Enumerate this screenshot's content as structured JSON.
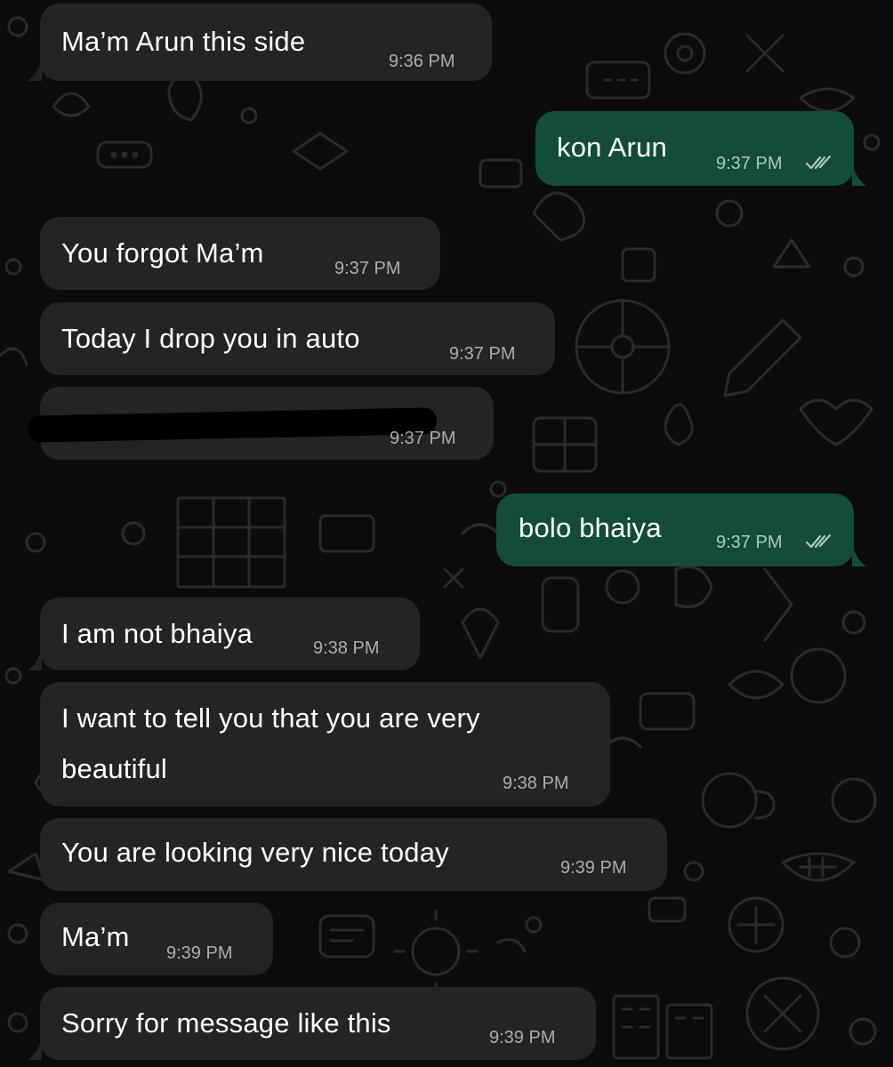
{
  "colors": {
    "background": "#0b0b0b",
    "incoming_bubble": "#242424",
    "outgoing_bubble": "#134d37",
    "doodle": "#2a2a2a"
  },
  "messages": [
    {
      "dir": "in",
      "text": "Ma’m Arun this side",
      "time": "9:36 PM"
    },
    {
      "dir": "out",
      "text": "kon Arun",
      "time": "9:37 PM",
      "status": "read-ticks-icon"
    },
    {
      "dir": "in",
      "text": "You forgot Ma’m",
      "time": "9:37 PM"
    },
    {
      "dir": "in",
      "text": "Today I drop you in auto",
      "time": "9:37 PM"
    },
    {
      "dir": "in",
      "text": "",
      "time": "9:37 PM",
      "redacted": true
    },
    {
      "dir": "out",
      "text": "bolo bhaiya",
      "time": "9:37 PM",
      "status": "read-ticks-icon"
    },
    {
      "dir": "in",
      "text": "I am not bhaiya",
      "time": "9:38 PM"
    },
    {
      "dir": "in",
      "lines": [
        "I want to tell you that you are very",
        "beautiful"
      ],
      "time": "9:38 PM"
    },
    {
      "dir": "in",
      "text": "You are looking very nice today",
      "time": "9:39 PM"
    },
    {
      "dir": "in",
      "text": "Ma’m",
      "time": "9:39 PM"
    },
    {
      "dir": "in",
      "text": "Sorry for message like this",
      "time": "9:39 PM"
    }
  ]
}
